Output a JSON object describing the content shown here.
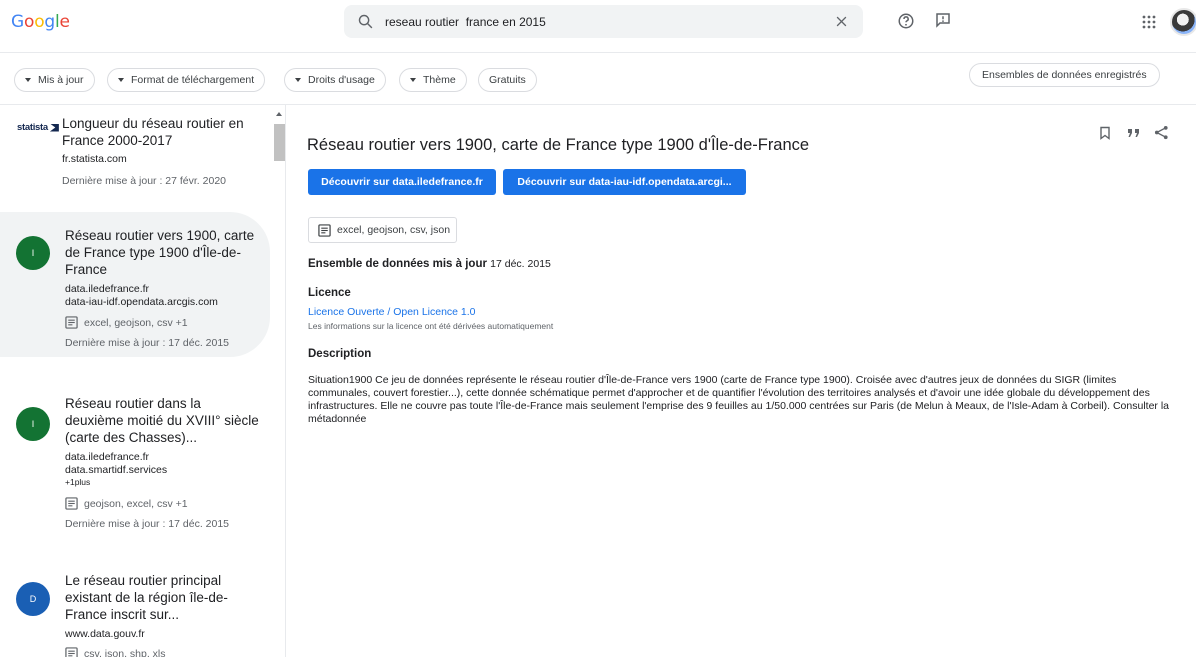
{
  "header": {
    "logo": "Google",
    "logo_colors": [
      "#4285F4",
      "#EA4335",
      "#FBBC05",
      "#4285F4",
      "#34A853",
      "#EA4335"
    ],
    "search_query": "reseau routier  france en 2015"
  },
  "filters": {
    "chips": [
      "Mis à jour",
      "Format de téléchargement",
      "Droits d'usage",
      "Thème",
      "Gratuits"
    ],
    "saved_label": "Ensembles de données enregistrés"
  },
  "results": [
    {
      "logo": "statista",
      "title_lines": [
        "Longueur du réseau routier en",
        "France 2000-2017"
      ],
      "sources": [
        "fr.statista.com"
      ],
      "updated": "Dernière mise à jour : 27 févr. 2020"
    },
    {
      "badge": "I",
      "badge_color": "#137333",
      "title_lines": [
        "Réseau routier vers 1900, carte",
        "de France type 1900 d'Île-de-",
        "France"
      ],
      "sources": [
        "data.iledefrance.fr",
        "data-iau-idf.opendata.arcgis.com"
      ],
      "formats": "excel, geojson, csv +1",
      "updated": "Dernière mise à jour : 17 déc. 2015"
    },
    {
      "badge": "I",
      "badge_color": "#137333",
      "title_lines": [
        "Réseau routier dans la",
        "deuxième moitié du XVIII° siècle",
        "(carte des Chasses)..."
      ],
      "sources": [
        "data.iledefrance.fr",
        "data.smartidf.services"
      ],
      "more": "+1plus",
      "formats": "geojson, excel, csv +1",
      "updated": "Dernière mise à jour : 17 déc. 2015"
    },
    {
      "badge": "D",
      "badge_color": "#1a5fb4",
      "title_lines": [
        "Le réseau routier principal",
        "existant de la région île-de-",
        "France inscrit sur..."
      ],
      "sources": [
        "www.data.gouv.fr"
      ],
      "formats": "csv, json, shp, xls"
    }
  ],
  "detail": {
    "title": "Réseau routier vers 1900, carte de France type 1900 d'Île-de-France",
    "button1": "Découvrir sur data.iledefrance.fr",
    "button2": "Découvrir sur data-iau-idf.opendata.arcgi...",
    "formats": "excel, geojson, csv, json",
    "updated_label": "Ensemble de données mis à jour",
    "updated_date": "17 déc. 2015",
    "licence_label": "Licence",
    "licence_link": "Licence Ouverte / Open Licence 1.0",
    "licence_note": "Les informations sur la licence ont été dérivées automatiquement",
    "description_label": "Description",
    "description": "Situation1900 Ce jeu de données représente le réseau routier d'Île-de-France vers 1900 (carte de France type 1900). Croisée avec d'autres jeux de données du SIGR (limites communales, couvert forestier...), cette donnée schématique permet d'approcher et de quantifier l'évolution des territoires analysés et d'avoir une idée globale du développement des infrastructures. Elle ne couvre pas toute l'Île-de-France mais seulement l'emprise des 9 feuilles au 1/50.000 centrées sur Paris (de Melun à Meaux, de l'Isle-Adam à Corbeil). Consulter la métadonnée"
  },
  "colors": {
    "accent": "#1a73e8",
    "selected_bg": "#f1f3f4"
  }
}
